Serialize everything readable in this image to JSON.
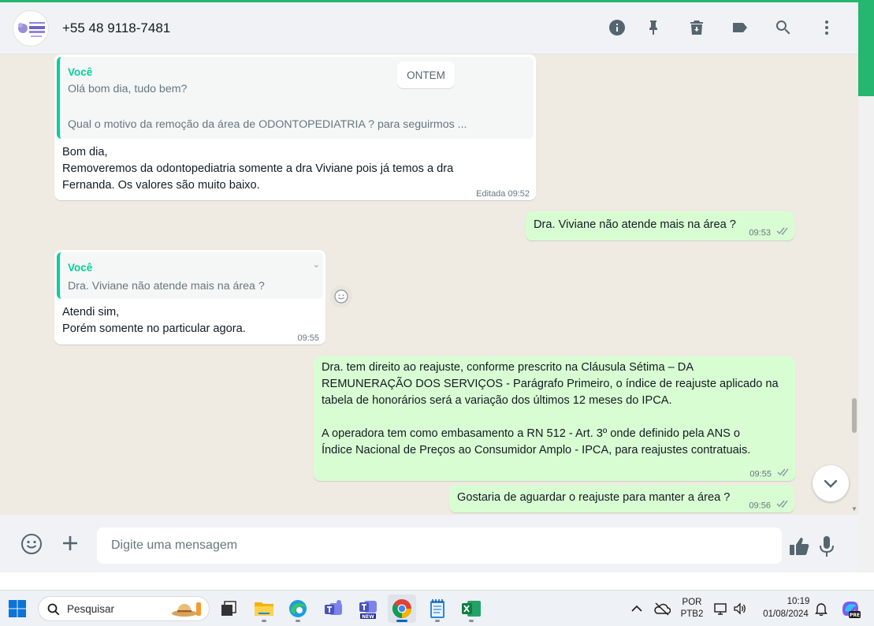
{
  "header": {
    "contact_name": "+55 48 9118-7481",
    "avatar_logo_text": "Clínica Viviane Marques",
    "icons": [
      "info-icon",
      "pin-icon",
      "delete-icon",
      "label-icon",
      "search-icon",
      "more-icon"
    ]
  },
  "chat": {
    "date_chip": "ONTEM",
    "messages": [
      {
        "direction": "in",
        "quote_author": "Você",
        "quote_line1": "Olá bom dia, tudo bem?",
        "quote_line2": "Qual o motivo da remoção da área de ODONTOPEDIATRIA ? para seguirmos ...",
        "lines": [
          "Bom dia,",
          "Removeremos da odontopediatria somente a dra Viviane pois já temos a dra",
          "Fernanda. Os valores são muito baixo."
        ],
        "meta": "Editada 09:52"
      },
      {
        "direction": "out",
        "lines": [
          "Dra. Viviane não atende mais na área ?"
        ],
        "time": "09:53"
      },
      {
        "direction": "in",
        "quote_author": "Você",
        "quote_line1": "Dra. Viviane não atende mais na área ?",
        "lines": [
          "Atendi sim,",
          "Porém somente no particular agora."
        ],
        "time": "09:55"
      },
      {
        "direction": "out",
        "lines": [
          "Dra. tem direito ao reajuste, conforme prescrito na Cláusula Sétima – DA",
          "REMUNERAÇÃO DOS SERVIÇOS - Parágrafo Primeiro, o índice de reajuste aplicado na",
          "tabela de honorários será a variação dos últimos 12 meses do IPCA.",
          "",
          "A operadora tem como embasamento a RN 512 - Art. 3º onde definido pela ANS o",
          "Índice Nacional de Preços ao Consumidor Amplo - IPCA, para reajustes contratuais."
        ],
        "time": "09:55"
      },
      {
        "direction": "out",
        "lines": [
          "Gostaria de aguardar o reajuste para manter a área ?"
        ],
        "time": "09:56"
      }
    ]
  },
  "composer": {
    "placeholder": "Digite uma mensagem"
  },
  "taskbar": {
    "search_label": "Pesquisar",
    "lang_line1": "POR",
    "lang_line2": "PTB2",
    "time": "10:19",
    "date": "01/08/2024",
    "copilot_badge": "PRE"
  },
  "colors": {
    "accent": "#25b66f",
    "outgoing_bubble": "#d9fdd3",
    "quote_author": "#06cf9c",
    "chat_bg": "#efeae2"
  }
}
